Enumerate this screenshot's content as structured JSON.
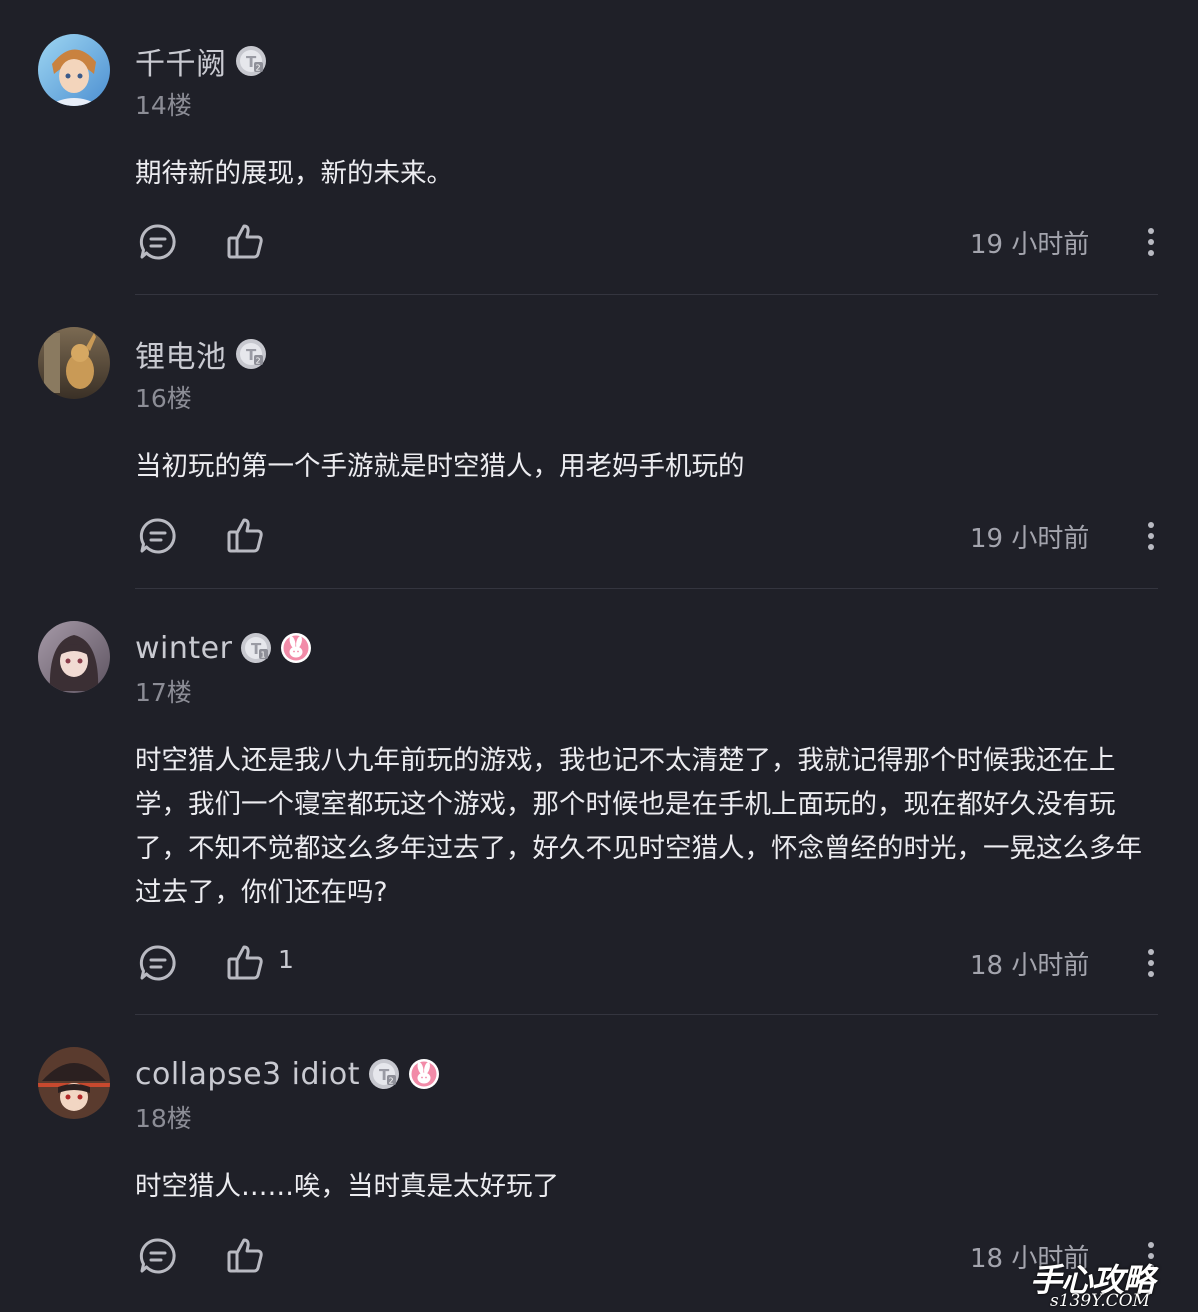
{
  "colors": {
    "background": "#1f2028",
    "divider": "#34353f",
    "text_primary": "#ececf0",
    "text_secondary": "#8c8d96",
    "icon": "#b9bac2"
  },
  "comments": [
    {
      "username": "千千阙",
      "floor": "14楼",
      "text": "期待新的展现，新的未来。",
      "likes": "",
      "time": "19 小时前",
      "badges": [
        "level-badge-icon"
      ]
    },
    {
      "username": "锂电池",
      "floor": "16楼",
      "text": "当初玩的第一个手游就是时空猎人，用老妈手机玩的",
      "likes": "",
      "time": "19 小时前",
      "badges": [
        "level-badge-icon"
      ]
    },
    {
      "username": "winter",
      "floor": "17楼",
      "text": "时空猎人还是我八九年前玩的游戏，我也记不太清楚了，我就记得那个时候我还在上学，我们一个寝室都玩这个游戏，那个时候也是在手机上面玩的，现在都好久没有玩了，不知不觉都这么多年过去了，好久不见时空猎人，怀念曾经的时光，一晃这么多年过去了，你们还在吗?",
      "likes": "1",
      "time": "18 小时前",
      "badges": [
        "level-badge-icon",
        "bunny-badge-icon"
      ]
    },
    {
      "username": "collapse3 idiot",
      "floor": "18楼",
      "text": "时空猎人……唉，当时真是太好玩了",
      "likes": "",
      "time": "18 小时前",
      "badges": [
        "level-badge-icon",
        "bunny-badge-icon"
      ]
    }
  ],
  "watermark": {
    "title": "手心攻略",
    "url": "s139Y.COM"
  }
}
